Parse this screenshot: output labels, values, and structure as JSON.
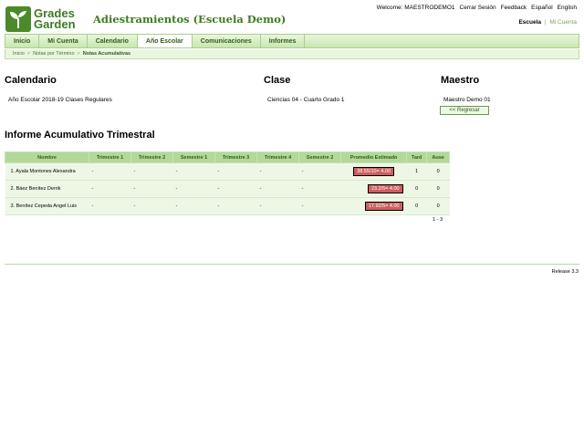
{
  "brand": {
    "line1": "Grades",
    "line2": "Garden"
  },
  "app_title": "Adiestramientos (Escuela Demo)",
  "top_links": [
    "Welcome: MAESTRODEMO1",
    "Cerrar Sesión",
    "Feedback",
    "Español",
    "English"
  ],
  "school_nav": {
    "active": "Escuela",
    "separator": "|",
    "other": "Mi Cuenta"
  },
  "nav_tabs": [
    "Inicio",
    "Mi Cuenta",
    "Calendario",
    "Año Escolar",
    "Comunicaciones",
    "Informes"
  ],
  "breadcrumbs": {
    "items": [
      "Inicio",
      "Notas por Término"
    ],
    "current": "Notas Acumulativas",
    "sep": ">"
  },
  "headers": {
    "calendar": "Calendario",
    "class": "Clase",
    "teacher": "Maestro"
  },
  "info": {
    "calendar": "Año Escolar 2018-19   Clases Regulares",
    "class": "Ciencias 04 -   Cuarto Grado   1",
    "teacher": "Maestro Demo 01"
  },
  "back_label": "<< Regresar",
  "report_title": "Informe Acumulativo Trimestral",
  "columns": [
    "Nombre",
    "Trimestre 1",
    "Trimestre 2",
    "Semestre 1",
    "Trimestre 3",
    "Trimestre 4",
    "Semestre 2",
    "Promedio Estimado",
    "Tard",
    "Ause"
  ],
  "rows": [
    {
      "name": "1. Ayala Montones Alexandra",
      "t1": "-",
      "t2": "-",
      "s1": "-",
      "t3": "-",
      "t4": "-",
      "s2": "-",
      "avg": "38.55/10= 4.00",
      "tard": "1",
      "ause": "0"
    },
    {
      "name": "2. Báez Benítez Derrik",
      "t1": "-",
      "t2": "-",
      "s1": "-",
      "t3": "-",
      "t4": "-",
      "s2": "-",
      "avg": "23.2/5= 4.00",
      "tard": "0",
      "ause": "0"
    },
    {
      "name": "3. Benítez Cepeda Angel Luis",
      "t1": "-",
      "t2": "-",
      "s1": "-",
      "t3": "-",
      "t4": "-",
      "s2": "-",
      "avg": "17.92/5= 4.00",
      "tard": "0",
      "ause": "0"
    }
  ],
  "pager": "1 - 3",
  "release": "Release 3.3",
  "colors": {
    "brand": "#3d7a22",
    "nav_bg": "#c9e6b0",
    "grade_bg": "#cc5f5f"
  }
}
